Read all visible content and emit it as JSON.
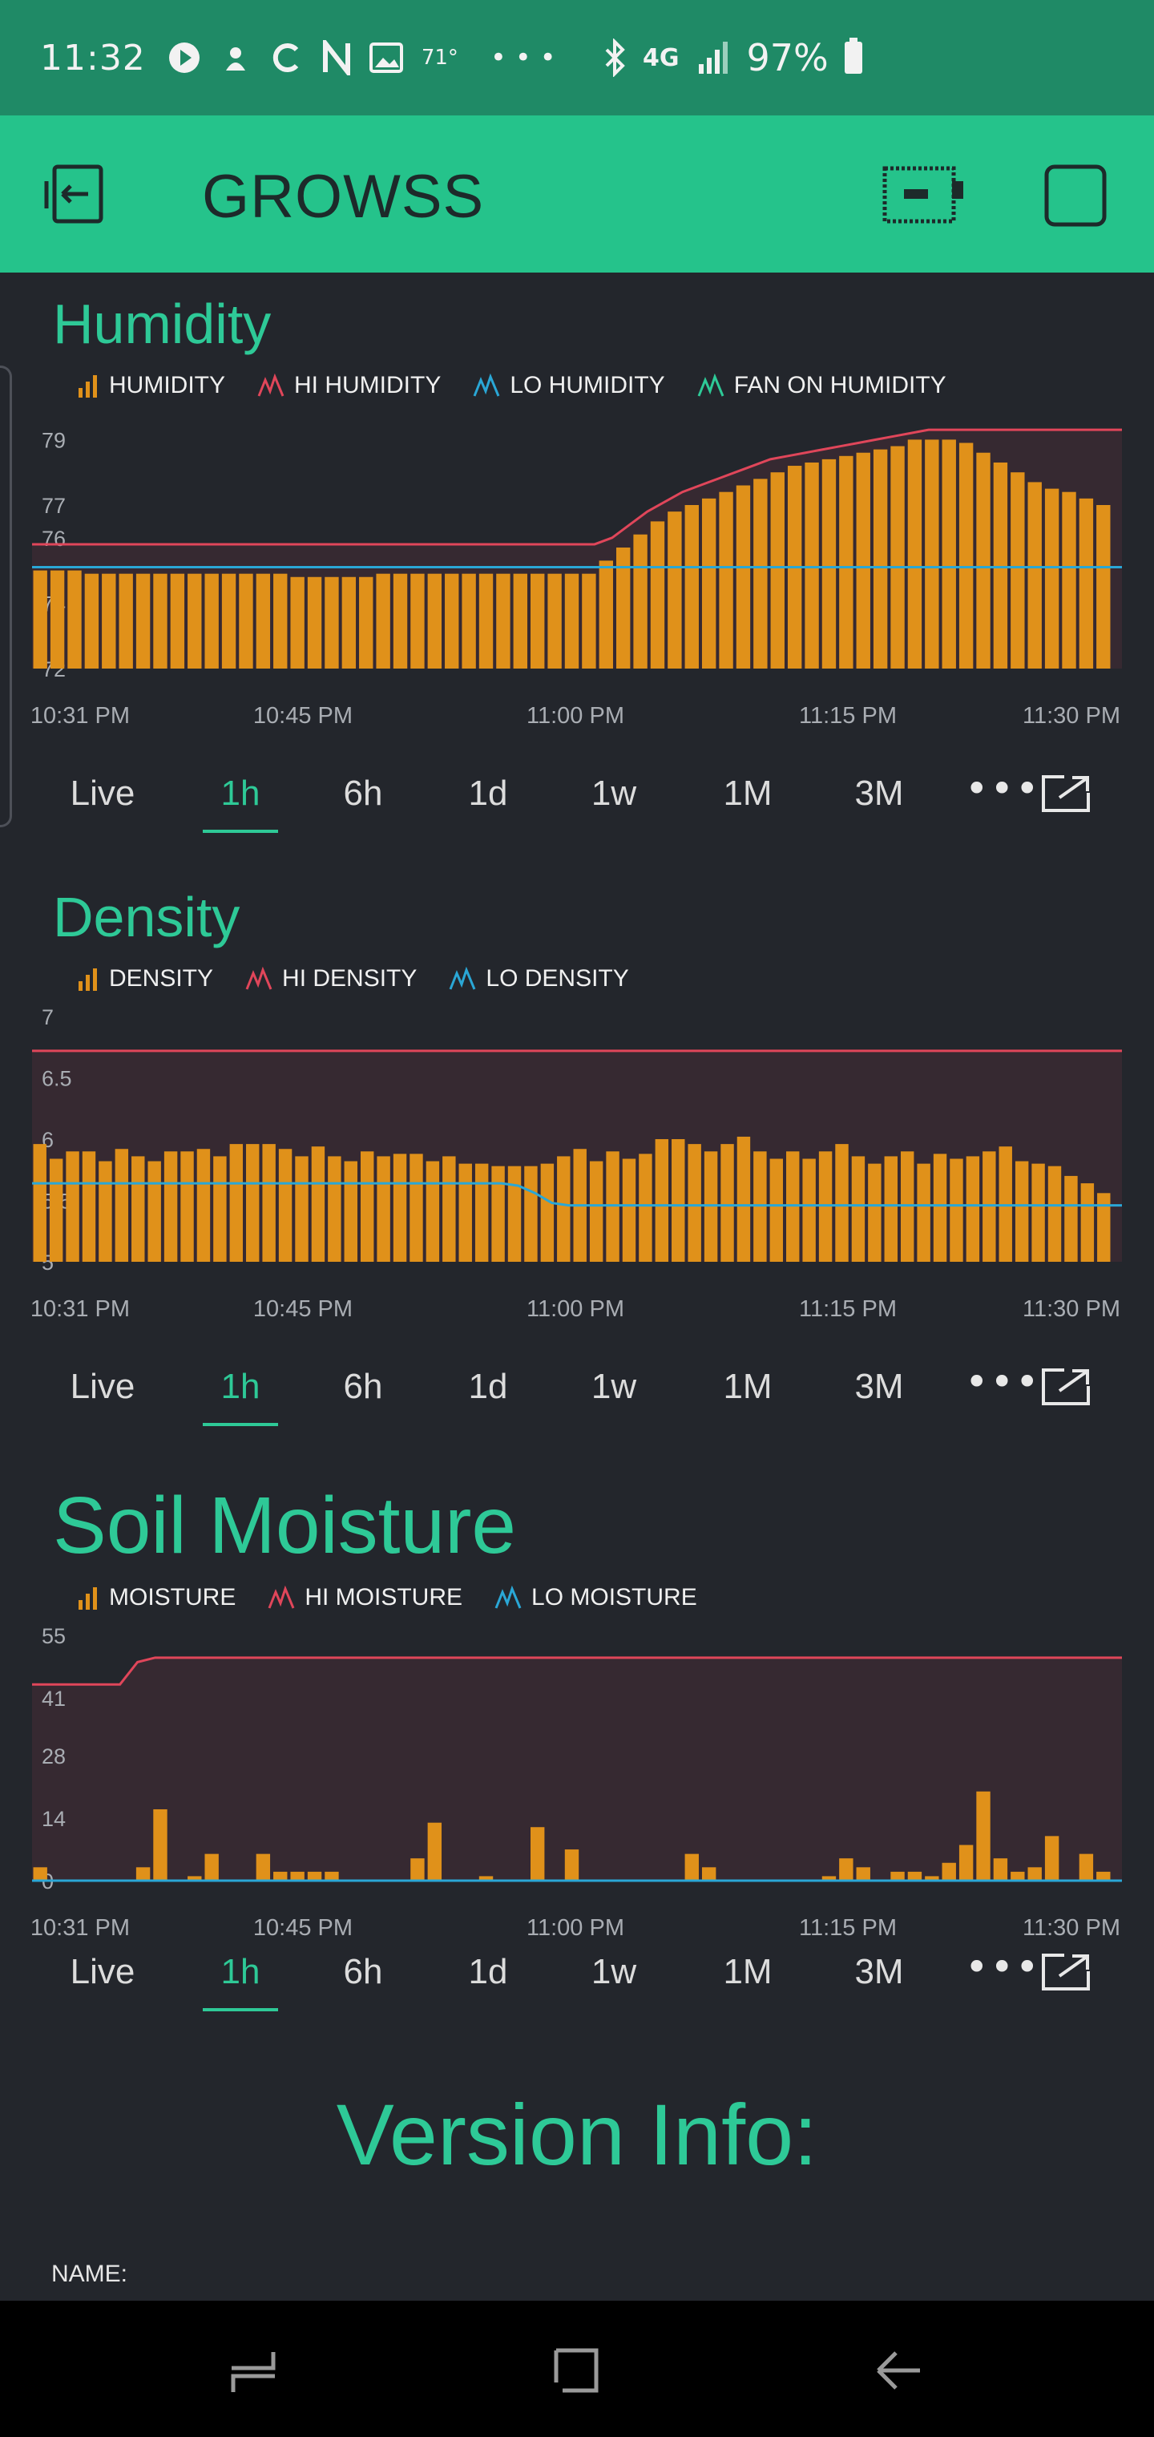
{
  "status_bar": {
    "time": "11:32",
    "temp": "71°",
    "network": "4G",
    "battery": "97%"
  },
  "app": {
    "title": "GROWSS"
  },
  "icons": {
    "back": "exit-icon",
    "device": "device-status-icon",
    "square": "square-icon"
  },
  "colors": {
    "accent": "#2ec997",
    "bar": "#e0911a",
    "hi_line": "#e0465a",
    "lo_line": "#2aa7d6",
    "fan_line": "#2ec997",
    "background": "#23262c",
    "appbar": "#25c38b"
  },
  "periods": [
    "Live",
    "1h",
    "6h",
    "1d",
    "1w",
    "1M",
    "3M"
  ],
  "active_period": "1h",
  "widgets": {
    "humidity": {
      "title": "Humidity",
      "legend": [
        "HUMIDITY",
        "HI HUMIDITY",
        "LO HUMIDITY",
        "FAN ON HUMIDITY"
      ]
    },
    "density": {
      "title": "Density",
      "legend": [
        "DENSITY",
        "HI DENSITY",
        "LO DENSITY"
      ]
    },
    "soil": {
      "title": "Soil Moisture",
      "legend": [
        "MOISTURE",
        "HI MOISTURE",
        "LO MOISTURE"
      ]
    }
  },
  "version": {
    "title": "Version Info:",
    "name_label": "NAME:"
  },
  "chart_data": [
    {
      "type": "bar",
      "title": "Humidity",
      "x_ticks": [
        "10:31 PM",
        "10:45 PM",
        "11:00 PM",
        "11:15 PM",
        "11:30 PM"
      ],
      "y_ticks": [
        72,
        74,
        76,
        77,
        79
      ],
      "ylim": [
        72,
        79.5
      ],
      "series": [
        {
          "name": "HUMIDITY",
          "type": "bar",
          "values": [
            75.0,
            75.0,
            75.0,
            74.9,
            74.9,
            74.9,
            74.9,
            74.9,
            74.9,
            74.9,
            74.9,
            74.9,
            74.9,
            74.9,
            74.9,
            74.8,
            74.8,
            74.8,
            74.8,
            74.8,
            74.9,
            74.9,
            74.9,
            74.9,
            74.9,
            74.9,
            74.9,
            74.9,
            74.9,
            74.9,
            74.9,
            74.9,
            74.9,
            75.3,
            75.7,
            76.1,
            76.5,
            76.8,
            77.0,
            77.2,
            77.4,
            77.6,
            77.8,
            78.0,
            78.2,
            78.3,
            78.4,
            78.5,
            78.6,
            78.7,
            78.8,
            79.0,
            79.0,
            79.0,
            78.9,
            78.6,
            78.3,
            78.0,
            77.7,
            77.5,
            77.4,
            77.2,
            77.0
          ]
        },
        {
          "name": "HI HUMIDITY",
          "type": "line",
          "values": [
            75.8,
            75.8,
            75.8,
            75.8,
            75.8,
            75.8,
            75.8,
            75.8,
            75.8,
            75.8,
            75.8,
            75.8,
            75.8,
            75.8,
            75.8,
            75.8,
            75.8,
            75.8,
            75.8,
            75.8,
            75.8,
            75.8,
            75.8,
            75.8,
            75.8,
            75.8,
            75.8,
            75.8,
            75.8,
            75.8,
            75.8,
            75.8,
            75.8,
            76.0,
            76.4,
            76.8,
            77.1,
            77.4,
            77.6,
            77.8,
            78.0,
            78.2,
            78.4,
            78.5,
            78.6,
            78.7,
            78.8,
            78.9,
            79.0,
            79.1,
            79.2,
            79.3,
            79.3,
            79.3,
            79.3,
            79.3,
            79.3,
            79.3,
            79.3,
            79.3,
            79.3,
            79.3,
            79.3
          ]
        },
        {
          "name": "LO HUMIDITY",
          "type": "line",
          "values": [
            75.1,
            75.1
          ]
        },
        {
          "name": "FAN ON HUMIDITY",
          "type": "line",
          "values": []
        }
      ]
    },
    {
      "type": "bar",
      "title": "Density",
      "x_ticks": [
        "10:31 PM",
        "10:45 PM",
        "11:00 PM",
        "11:15 PM",
        "11:30 PM"
      ],
      "y_ticks": [
        5.0,
        5.5,
        6.0,
        6.5,
        7.0
      ],
      "ylim": [
        5.0,
        7.0
      ],
      "series": [
        {
          "name": "DENSITY",
          "type": "bar",
          "values": [
            5.96,
            5.84,
            5.9,
            5.9,
            5.82,
            5.92,
            5.86,
            5.82,
            5.9,
            5.9,
            5.92,
            5.86,
            5.96,
            5.96,
            5.96,
            5.92,
            5.86,
            5.94,
            5.86,
            5.82,
            5.9,
            5.86,
            5.88,
            5.88,
            5.82,
            5.86,
            5.8,
            5.8,
            5.78,
            5.78,
            5.78,
            5.8,
            5.86,
            5.92,
            5.82,
            5.9,
            5.84,
            5.88,
            6.0,
            6.0,
            5.96,
            5.9,
            5.96,
            6.02,
            5.9,
            5.84,
            5.9,
            5.84,
            5.9,
            5.96,
            5.86,
            5.8,
            5.86,
            5.9,
            5.8,
            5.88,
            5.84,
            5.86,
            5.9,
            5.94,
            5.82,
            5.8,
            5.78,
            5.7,
            5.64,
            5.56
          ]
        },
        {
          "name": "HI DENSITY",
          "type": "line",
          "values": [
            6.72,
            6.72
          ]
        },
        {
          "name": "LO DENSITY",
          "type": "line",
          "values": [
            5.64,
            5.64,
            5.64,
            5.64,
            5.64,
            5.64,
            5.64,
            5.64,
            5.64,
            5.64,
            5.64,
            5.64,
            5.64,
            5.64,
            5.64,
            5.64,
            5.64,
            5.64,
            5.64,
            5.64,
            5.64,
            5.64,
            5.64,
            5.64,
            5.64,
            5.64,
            5.64,
            5.64,
            5.64,
            5.62,
            5.56,
            5.48,
            5.46,
            5.46,
            5.46,
            5.46,
            5.46,
            5.46,
            5.46,
            5.46,
            5.46,
            5.46,
            5.46,
            5.46,
            5.46,
            5.46,
            5.46,
            5.46,
            5.46,
            5.46,
            5.46,
            5.46,
            5.46,
            5.46,
            5.46,
            5.46,
            5.46,
            5.46,
            5.46,
            5.46,
            5.46,
            5.46,
            5.46,
            5.46,
            5.46,
            5.46
          ]
        }
      ]
    },
    {
      "type": "bar",
      "title": "Soil Moisture",
      "x_ticks": [
        "10:31 PM",
        "10:45 PM",
        "11:00 PM",
        "11:15 PM",
        "11:30 PM"
      ],
      "y_ticks": [
        0,
        14,
        28,
        41,
        55
      ],
      "ylim": [
        0,
        55
      ],
      "series": [
        {
          "name": "MOISTURE",
          "type": "bar",
          "values": [
            3,
            0,
            0,
            0,
            0,
            0,
            3,
            16,
            0,
            1,
            6,
            0,
            0,
            6,
            2,
            2,
            2,
            2,
            0,
            0,
            0,
            0,
            5,
            13,
            0,
            0,
            1,
            0,
            0,
            12,
            0,
            7,
            0,
            0,
            0,
            0,
            0,
            0,
            6,
            3,
            0,
            0,
            0,
            0,
            0,
            0,
            1,
            5,
            3,
            0,
            2,
            2,
            1,
            4,
            8,
            20,
            5,
            2,
            3,
            10,
            0,
            6,
            2
          ]
        },
        {
          "name": "HI MOISTURE",
          "type": "line",
          "values": [
            44,
            44,
            44,
            44,
            44,
            44,
            49,
            50,
            50,
            50,
            50,
            50,
            50,
            50,
            50,
            50,
            50,
            50,
            50,
            50,
            50,
            50,
            50,
            50,
            50,
            50,
            50,
            50,
            50,
            50,
            50,
            50,
            50,
            50,
            50,
            50,
            50,
            50,
            50,
            50,
            50,
            50,
            50,
            50,
            50,
            50,
            50,
            50,
            50,
            50,
            50,
            50,
            50,
            50,
            50,
            50,
            50,
            50,
            50,
            50,
            50,
            50,
            50
          ]
        },
        {
          "name": "LO MOISTURE",
          "type": "line",
          "values": [
            0,
            0
          ]
        }
      ]
    }
  ]
}
